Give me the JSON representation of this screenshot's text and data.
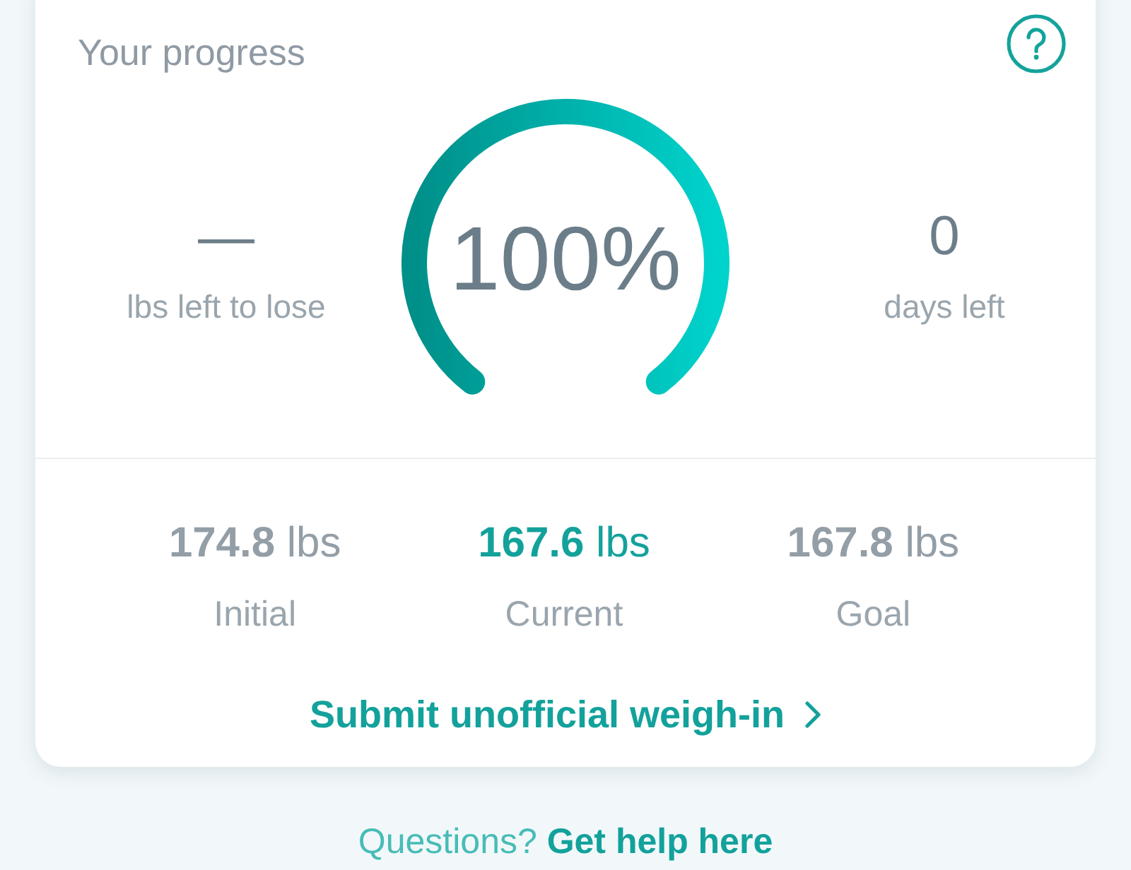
{
  "progress_card": {
    "title": "Your progress",
    "left_stat": {
      "value": "—",
      "label": "lbs left to lose"
    },
    "gauge": {
      "level": 1,
      "reading": "100%"
    },
    "right_stat": {
      "value": "0",
      "label": "days left"
    },
    "weights": [
      {
        "value": "174.8",
        "unit": "lbs",
        "label": "Initial",
        "highlighted": false
      },
      {
        "value": "167.6",
        "unit": "lbs",
        "label": "Current",
        "highlighted": true
      },
      {
        "value": "167.8",
        "unit": "lbs",
        "label": "Goal",
        "highlighted": false
      }
    ],
    "link": {
      "label": "Submit unofficial weigh-in"
    }
  },
  "help_line": {
    "text": "Questions?",
    "link": "Get help here"
  }
}
